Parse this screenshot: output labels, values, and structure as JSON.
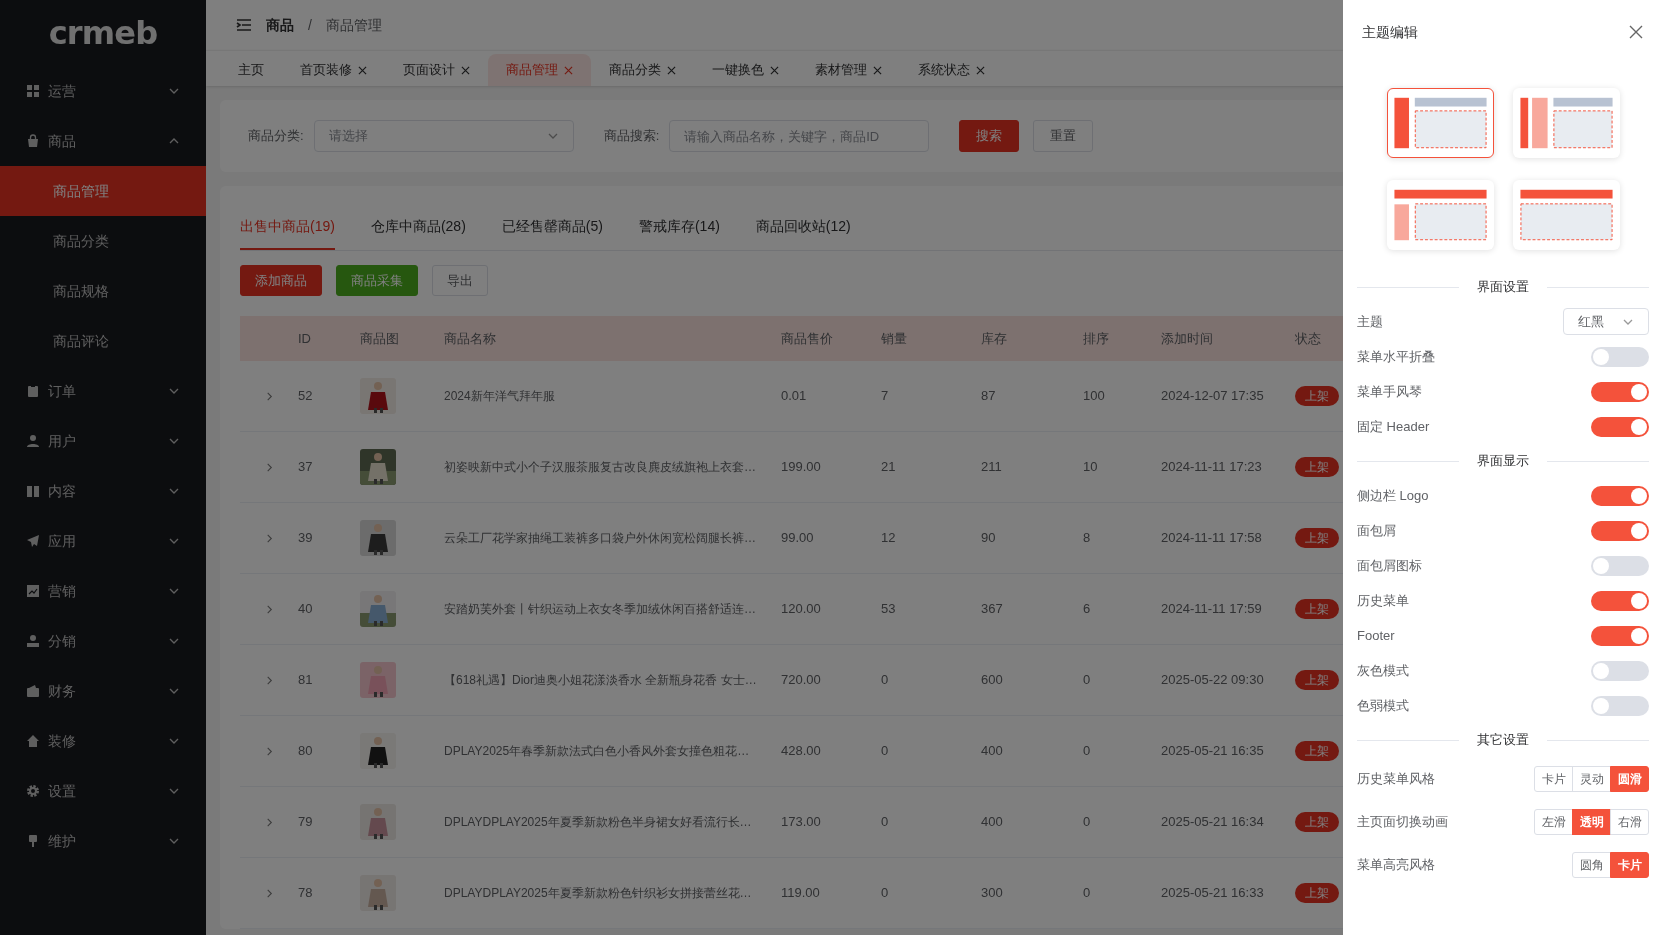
{
  "sidebar": {
    "logo": "crmeb",
    "items": [
      {
        "label": "运营",
        "expanded": false
      },
      {
        "label": "商品",
        "expanded": true,
        "children": [
          {
            "label": "商品管理",
            "selected": true
          },
          {
            "label": "商品分类",
            "selected": false
          },
          {
            "label": "商品规格",
            "selected": false
          },
          {
            "label": "商品评论",
            "selected": false
          }
        ]
      },
      {
        "label": "订单",
        "expanded": false
      },
      {
        "label": "用户",
        "expanded": false
      },
      {
        "label": "内容",
        "expanded": false
      },
      {
        "label": "应用",
        "expanded": false
      },
      {
        "label": "营销",
        "expanded": false
      },
      {
        "label": "分销",
        "expanded": false
      },
      {
        "label": "财务",
        "expanded": false
      },
      {
        "label": "装修",
        "expanded": false
      },
      {
        "label": "设置",
        "expanded": false
      },
      {
        "label": "维护",
        "expanded": false
      }
    ]
  },
  "breadcrumb": {
    "items": [
      "商品",
      "商品管理"
    ],
    "separator": "/"
  },
  "history_tabs": [
    {
      "label": "主页",
      "closable": false,
      "selected": false
    },
    {
      "label": "首页装修",
      "closable": true,
      "selected": false
    },
    {
      "label": "页面设计",
      "closable": true,
      "selected": false
    },
    {
      "label": "商品管理",
      "closable": true,
      "selected": true
    },
    {
      "label": "商品分类",
      "closable": true,
      "selected": false
    },
    {
      "label": "一键换色",
      "closable": true,
      "selected": false
    },
    {
      "label": "素材管理",
      "closable": true,
      "selected": false
    },
    {
      "label": "系统状态",
      "closable": true,
      "selected": false
    }
  ],
  "filters": {
    "category_label": "商品分类:",
    "category_placeholder": "请选择",
    "search_label": "商品搜索:",
    "search_placeholder": "请输入商品名称，关键字，商品ID",
    "buttons": [
      {
        "label": "搜索",
        "kind": "primary"
      },
      {
        "label": "重置",
        "kind": "default"
      }
    ]
  },
  "product_tabs": [
    {
      "label": "出售中商品(19)",
      "selected": true
    },
    {
      "label": "仓库中商品(28)",
      "selected": false
    },
    {
      "label": "已经售罄商品(5)",
      "selected": false
    },
    {
      "label": "警戒库存(14)",
      "selected": false
    },
    {
      "label": "商品回收站(12)",
      "selected": false
    }
  ],
  "actions": [
    {
      "label": "添加商品",
      "kind": "primary"
    },
    {
      "label": "商品采集",
      "kind": "success"
    },
    {
      "label": "导出",
      "kind": "default"
    }
  ],
  "table": {
    "columns": [
      "ID",
      "商品图",
      "商品名称",
      "商品售价",
      "销量",
      "库存",
      "排序",
      "添加时间",
      "状态"
    ],
    "rows": [
      {
        "id": "52",
        "name": "2024新年洋气拜年服",
        "price": "0.01",
        "sales": "7",
        "stock": "87",
        "sort": "100",
        "time": "2024-12-07 17:35",
        "status": "上架"
      },
      {
        "id": "37",
        "name": "初姿映新中式小个子汉服茶服复古改良麂皮绒旗袍上衣套…",
        "price": "199.00",
        "sales": "21",
        "stock": "211",
        "sort": "10",
        "time": "2024-11-11 17:23",
        "status": "上架"
      },
      {
        "id": "39",
        "name": "云朵工厂花学家抽绳工装裤多口袋户外休闲宽松阔腿长裤…",
        "price": "99.00",
        "sales": "12",
        "stock": "90",
        "sort": "8",
        "time": "2024-11-11 17:58",
        "status": "上架"
      },
      {
        "id": "40",
        "name": "安踏奶芙外套丨针织运动上衣女冬季加绒休闲百搭舒适连…",
        "price": "120.00",
        "sales": "53",
        "stock": "367",
        "sort": "6",
        "time": "2024-11-11 17:59",
        "status": "上架"
      },
      {
        "id": "81",
        "name": "【618礼遇】Dior迪奥小姐花漾淡香水 全新瓶身花香 女士…",
        "price": "720.00",
        "sales": "0",
        "stock": "600",
        "sort": "0",
        "time": "2025-05-22 09:30",
        "status": "上架"
      },
      {
        "id": "80",
        "name": "DPLAY2025年春季新款法式白色小香风外套女撞色粗花…",
        "price": "428.00",
        "sales": "0",
        "stock": "400",
        "sort": "0",
        "time": "2025-05-21 16:35",
        "status": "上架"
      },
      {
        "id": "79",
        "name": "DPLAYDPLAY2025年夏季新款粉色半身裙女好看流行长…",
        "price": "173.00",
        "sales": "0",
        "stock": "400",
        "sort": "0",
        "time": "2025-05-21 16:34",
        "status": "上架"
      },
      {
        "id": "78",
        "name": "DPLAYDPLAY2025年夏季新款粉色针织衫女拼接蕾丝花…",
        "price": "119.00",
        "sales": "0",
        "stock": "300",
        "sort": "0",
        "time": "2025-05-21 16:33",
        "status": "上架"
      }
    ]
  },
  "drawer": {
    "title": "主题编辑",
    "layouts": [
      {
        "kind": "side",
        "selected": true
      },
      {
        "kind": "double-side",
        "selected": false
      },
      {
        "kind": "top-side",
        "selected": false
      },
      {
        "kind": "top",
        "selected": false
      }
    ],
    "sections": [
      {
        "title": "界面设置",
        "items": [
          {
            "kind": "select",
            "label": "主题",
            "value": "红黑"
          },
          {
            "kind": "toggle",
            "label": "菜单水平折叠",
            "on": false
          },
          {
            "kind": "toggle",
            "label": "菜单手风琴",
            "on": true
          },
          {
            "kind": "toggle",
            "label": "固定 Header",
            "on": true
          }
        ]
      },
      {
        "title": "界面显示",
        "items": [
          {
            "kind": "toggle",
            "label": "侧边栏 Logo",
            "on": true
          },
          {
            "kind": "toggle",
            "label": "面包屑",
            "on": true
          },
          {
            "kind": "toggle",
            "label": "面包屑图标",
            "on": false
          },
          {
            "kind": "toggle",
            "label": "历史菜单",
            "on": true
          },
          {
            "kind": "toggle",
            "label": "Footer",
            "on": true
          },
          {
            "kind": "toggle",
            "label": "灰色模式",
            "on": false
          },
          {
            "kind": "toggle",
            "label": "色弱模式",
            "on": false
          }
        ]
      },
      {
        "title": "其它设置",
        "items": [
          {
            "kind": "segmented",
            "label": "历史菜单风格",
            "options": [
              {
                "label": "卡片",
                "selected": false
              },
              {
                "label": "灵动",
                "selected": false
              },
              {
                "label": "圆滑",
                "selected": true
              }
            ]
          },
          {
            "kind": "segmented",
            "label": "主页面切换动画",
            "options": [
              {
                "label": "左滑",
                "selected": false
              },
              {
                "label": "透明",
                "selected": true
              },
              {
                "label": "右滑",
                "selected": false
              }
            ]
          },
          {
            "kind": "segmented",
            "label": "菜单高亮风格",
            "options": [
              {
                "label": "圆角",
                "selected": false
              },
              {
                "label": "卡片",
                "selected": true
              }
            ]
          }
        ]
      }
    ]
  }
}
